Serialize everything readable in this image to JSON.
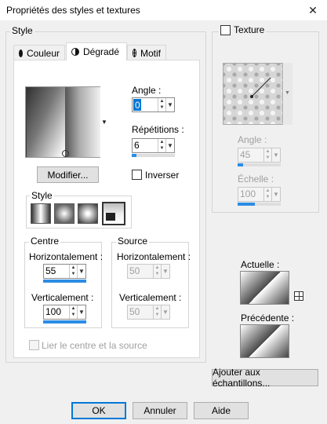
{
  "window": {
    "title": "Propriétés des styles et textures",
    "close_glyph": "✕"
  },
  "style_group": {
    "label": "Style",
    "tabs": [
      {
        "label": "Couleur",
        "icon": "filled-circle-icon"
      },
      {
        "label": "Dégradé",
        "icon": "half-circle-icon"
      },
      {
        "label": "Motif",
        "icon": "grid-globe-icon"
      }
    ],
    "active_tab": "Dégradé",
    "angle_label": "Angle :",
    "angle_value": "0",
    "repetitions_label": "Répétitions :",
    "repetitions_value": "6",
    "repetitions_level": 0.1,
    "modifier_label": "Modifier...",
    "inverser_label": "Inverser",
    "inverser_checked": false,
    "gradient_style_label": "Style",
    "gradient_styles": [
      "linear",
      "rectangular",
      "radial",
      "sunburst"
    ],
    "centre": {
      "label": "Centre",
      "horizontal_label": "Horizontalement :",
      "horizontal_value": "55",
      "vertical_label": "Verticalement :",
      "vertical_value": "100"
    },
    "source": {
      "label": "Source",
      "horizontal_label": "Horizontalement :",
      "horizontal_value": "50",
      "vertical_label": "Verticalement :",
      "vertical_value": "50"
    },
    "link_label": "Lier le centre et la source"
  },
  "texture_group": {
    "label": "Texture",
    "checked": false,
    "angle_label": "Angle :",
    "angle_value": "45",
    "echelle_label": "Échelle :",
    "echelle_value": "100"
  },
  "swatches": {
    "actuelle_label": "Actuelle :",
    "precedente_label": "Précédente :",
    "add_button_label": "Ajouter aux échantillons..."
  },
  "footer": {
    "ok_label": "OK",
    "cancel_label": "Annuler",
    "help_label": "Aide"
  },
  "colors": {
    "accent": "#0078d7",
    "level_bar": "#2c8ce3",
    "window_bg": "#f0f0f0"
  }
}
